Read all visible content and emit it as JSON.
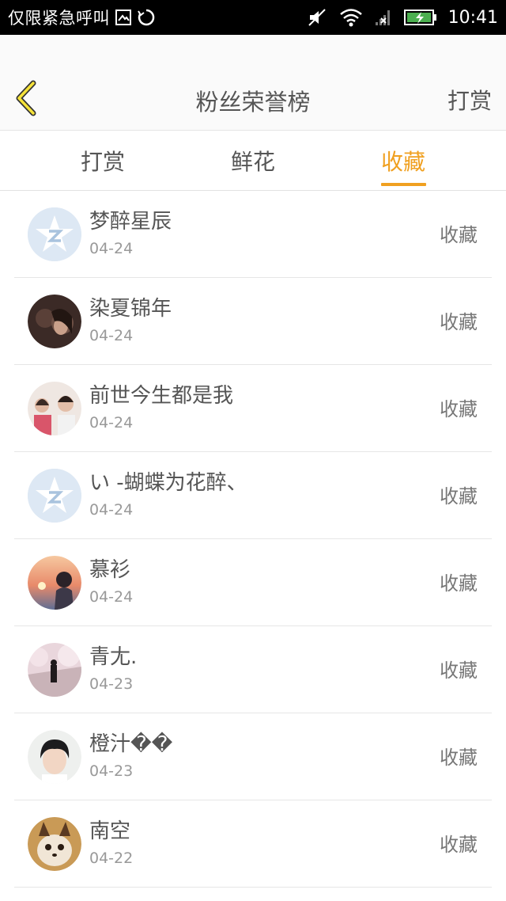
{
  "status_bar": {
    "carrier_text": "仅限紧急呼叫",
    "time": "10:41",
    "icons": [
      "image-icon",
      "sync-icon",
      "mute-icon",
      "wifi-icon",
      "no-signal-icon",
      "battery-charging-icon"
    ]
  },
  "header": {
    "title": "粉丝荣誉榜",
    "action_label": "打赏",
    "back_icon": "chevron-left-icon",
    "accent_color": "#f0a020"
  },
  "tabs": [
    {
      "label": "打赏",
      "active": false
    },
    {
      "label": "鲜花",
      "active": false
    },
    {
      "label": "收藏",
      "active": true
    }
  ],
  "fans": [
    {
      "name": "梦醉星辰",
      "date": "04-24",
      "gift": "收藏",
      "avatar": "default-star-avatar"
    },
    {
      "name": "染夏锦年",
      "date": "04-24",
      "gift": "收藏",
      "avatar": "photo-avatar"
    },
    {
      "name": "前世今生都是我",
      "date": "04-24",
      "gift": "收藏",
      "avatar": "photo-avatar"
    },
    {
      "name": "い -蝴蝶为花醉、",
      "date": "04-24",
      "gift": "收藏",
      "avatar": "default-star-avatar"
    },
    {
      "name": "慕衫",
      "date": "04-24",
      "gift": "收藏",
      "avatar": "photo-avatar"
    },
    {
      "name": "青尢.",
      "date": "04-23",
      "gift": "收藏",
      "avatar": "photo-avatar"
    },
    {
      "name": "橙汁��",
      "date": "04-23",
      "gift": "收藏",
      "avatar": "photo-avatar"
    },
    {
      "name": "南空",
      "date": "04-22",
      "gift": "收藏",
      "avatar": "photo-avatar"
    }
  ]
}
